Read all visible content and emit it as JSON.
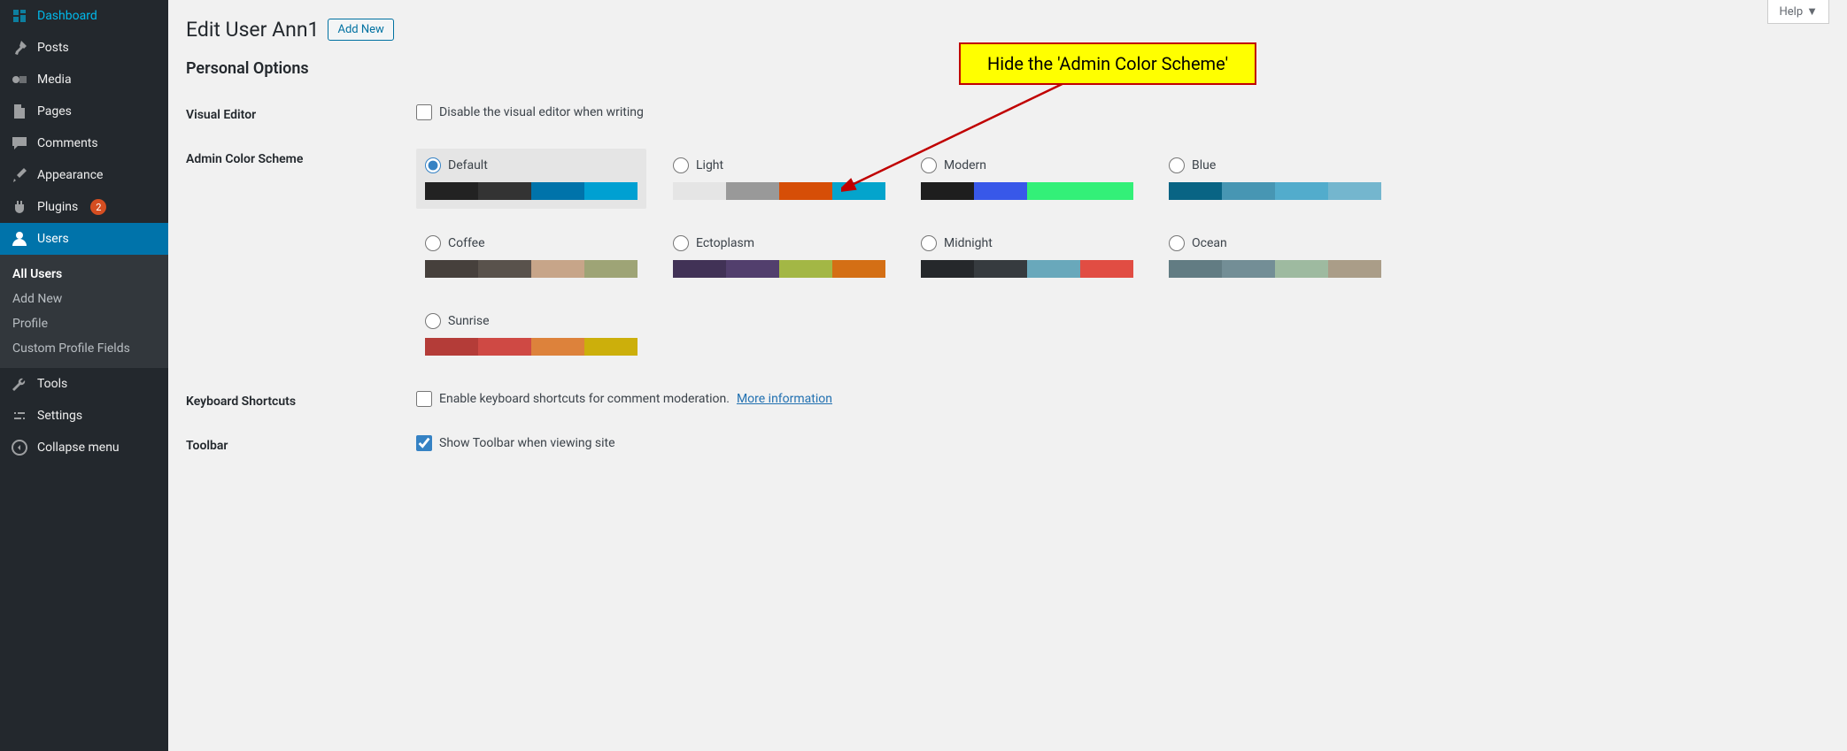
{
  "help_label": "Help",
  "sidebar": {
    "items": [
      {
        "icon": "dashboard-icon",
        "label": "Dashboard"
      },
      {
        "icon": "pin-icon",
        "label": "Posts"
      },
      {
        "icon": "media-icon",
        "label": "Media"
      },
      {
        "icon": "page-icon",
        "label": "Pages"
      },
      {
        "icon": "comment-icon",
        "label": "Comments"
      },
      {
        "icon": "brush-icon",
        "label": "Appearance"
      },
      {
        "icon": "plug-icon",
        "label": "Plugins",
        "badge": "2"
      },
      {
        "icon": "user-icon",
        "label": "Users",
        "active": true
      },
      {
        "icon": "wrench-icon",
        "label": "Tools"
      },
      {
        "icon": "settings-icon",
        "label": "Settings"
      }
    ],
    "submenu": [
      {
        "label": "All Users",
        "current": true
      },
      {
        "label": "Add New"
      },
      {
        "label": "Profile"
      },
      {
        "label": "Custom Profile Fields"
      }
    ],
    "collapse": "Collapse menu"
  },
  "page": {
    "title": "Edit User Ann1",
    "add_new": "Add New",
    "section": "Personal Options",
    "rows": {
      "visual_editor": {
        "label": "Visual Editor",
        "text": "Disable the visual editor when writing"
      },
      "color_scheme": {
        "label": "Admin Color Scheme"
      },
      "keyboard": {
        "label": "Keyboard Shortcuts",
        "text": "Enable keyboard shortcuts for comment moderation.",
        "link": "More information"
      },
      "toolbar": {
        "label": "Toolbar",
        "text": "Show Toolbar when viewing site",
        "checked": true
      }
    }
  },
  "annotation": {
    "text": "Hide the 'Admin Color Scheme'"
  },
  "schemes": [
    {
      "name": "Default",
      "selected": true,
      "colors": [
        "#222222",
        "#333333",
        "#0073aa",
        "#00a0d2"
      ]
    },
    {
      "name": "Light",
      "colors": [
        "#e5e5e5",
        "#999999",
        "#d64e07",
        "#04a4cc"
      ]
    },
    {
      "name": "Modern",
      "colors": [
        "#1e1e1e",
        "#3858e9",
        "#33f078",
        "#33f078"
      ]
    },
    {
      "name": "Blue",
      "colors": [
        "#096484",
        "#4796b3",
        "#52accc",
        "#74B6CE"
      ]
    },
    {
      "name": "Coffee",
      "colors": [
        "#46403c",
        "#59524c",
        "#c7a589",
        "#9ea476"
      ]
    },
    {
      "name": "Ectoplasm",
      "colors": [
        "#413256",
        "#523f6d",
        "#a3b745",
        "#d46f15"
      ]
    },
    {
      "name": "Midnight",
      "colors": [
        "#25282b",
        "#363b3f",
        "#69a8bb",
        "#e14d43"
      ]
    },
    {
      "name": "Ocean",
      "colors": [
        "#627c83",
        "#738e96",
        "#9ebaa0",
        "#aa9d88"
      ]
    },
    {
      "name": "Sunrise",
      "colors": [
        "#b43c38",
        "#cf4944",
        "#dd823b",
        "#ccaf0b"
      ]
    }
  ]
}
